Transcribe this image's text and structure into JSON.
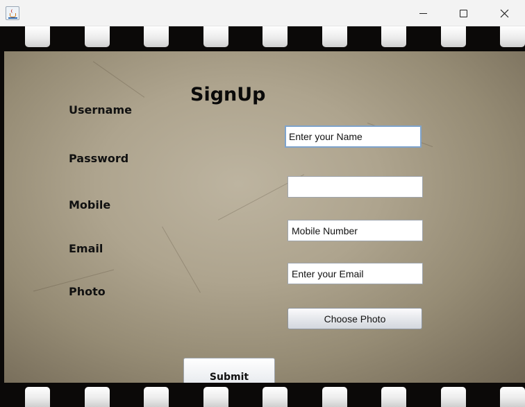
{
  "window": {
    "icon": "java-cup-icon",
    "controls": [
      "minimize-icon",
      "maximize-icon",
      "close-icon"
    ]
  },
  "form": {
    "title": "SignUp",
    "fields": [
      {
        "label": "Username",
        "value": "Enter your Name"
      },
      {
        "label": "Password",
        "value": ""
      },
      {
        "label": "Mobile",
        "value": "Mobile Number"
      },
      {
        "label": "Email",
        "value": "Enter your Email"
      },
      {
        "label": "Photo",
        "button": "Choose Photo"
      }
    ],
    "submit_label": "Submit"
  },
  "colors": {
    "frame": "#0b0908",
    "sprocket": "#e9e9e9",
    "parchment": "#aea48e",
    "focus_border": "#7ea3cc"
  }
}
